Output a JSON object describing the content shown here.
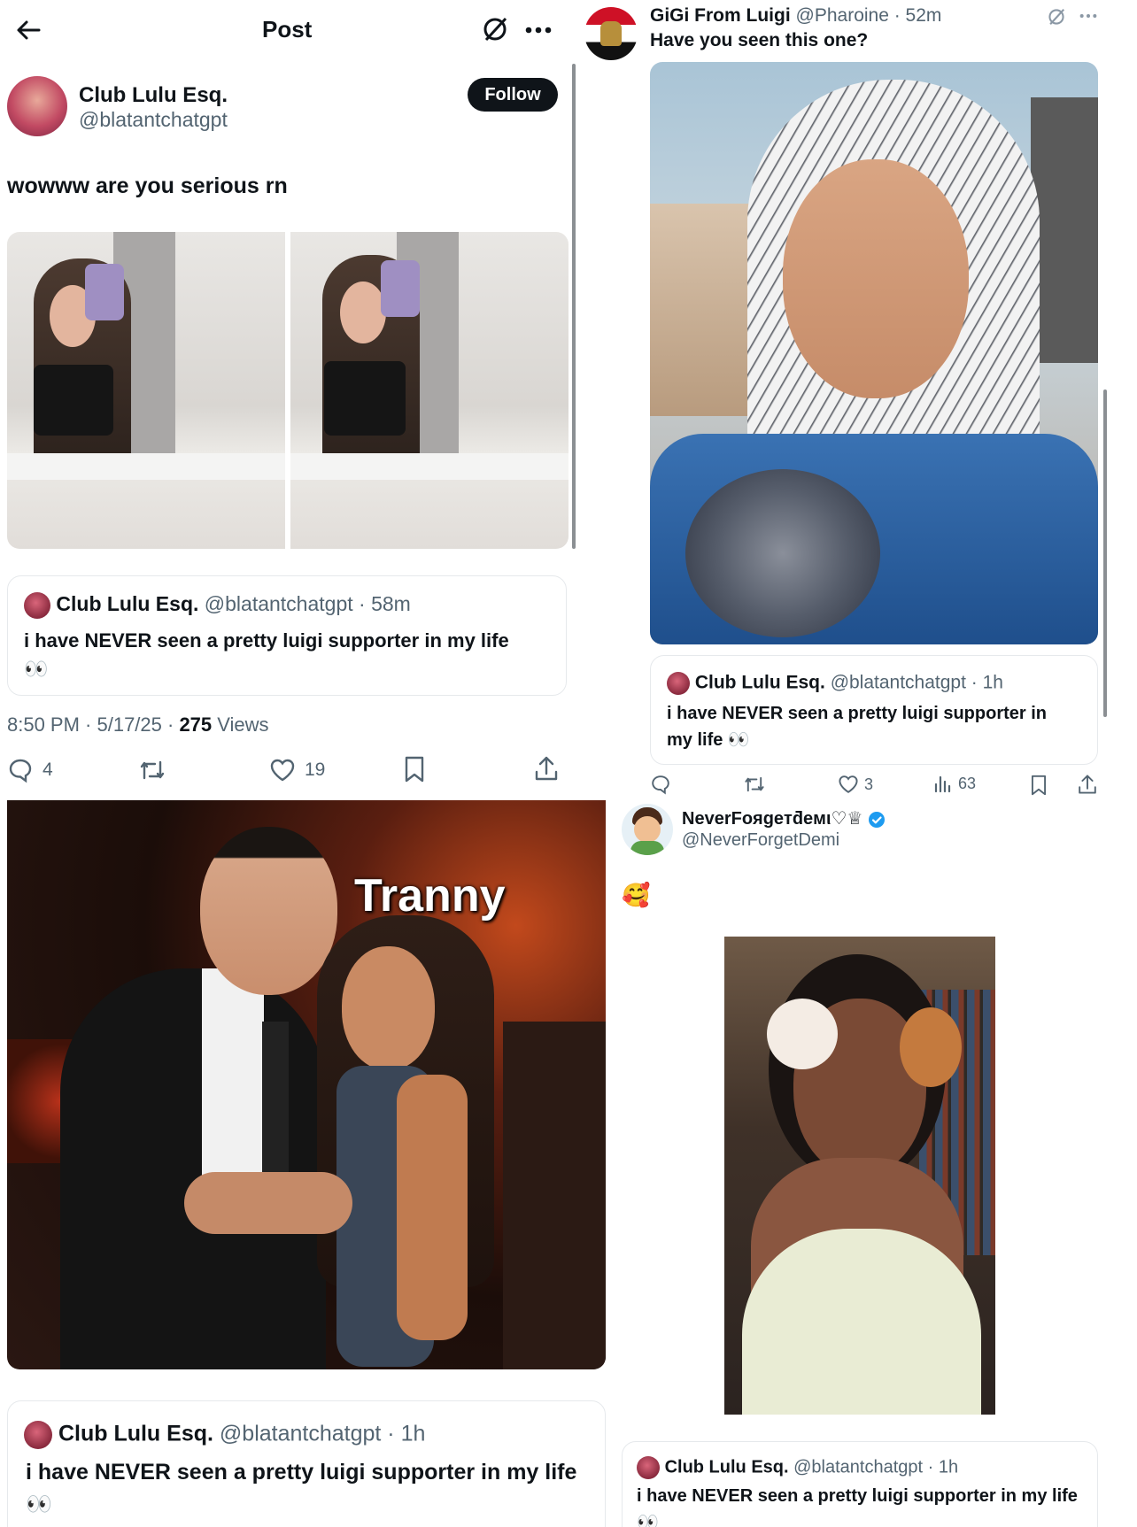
{
  "left": {
    "header": {
      "title": "Post"
    },
    "author": {
      "name": "Club Lulu Esq.",
      "handle": "@blatantchatgpt",
      "follow_label": "Follow"
    },
    "tweet_text": "wowww are you serious rn",
    "quote": {
      "name": "Club Lulu Esq.",
      "handle_time": "@blatantchatgpt · 58m",
      "text": "i have NEVER seen a pretty luigi supporter in my life",
      "emoji": "👀"
    },
    "meta": {
      "time_date": "8:50 PM · 5/17/25 · ",
      "views_count": "275",
      "views_label": " Views"
    },
    "actions": {
      "replies": "4",
      "likes": "19"
    }
  },
  "right_top": {
    "author": {
      "name": "GiGi From Luigi",
      "handle_time": "@Pharoine · 52m"
    },
    "text": "Have you seen this one?",
    "quote": {
      "name": "Club Lulu Esq.",
      "handle_time": "@blatantchatgpt · 1h",
      "text_line1": "i have NEVER seen a pretty luigi supporter in",
      "text_line2": "my life 👀"
    },
    "actions": {
      "likes": "3",
      "views": "63"
    }
  },
  "right_bottom": {
    "author": {
      "name": "NeverFoяgeтƌeмι♡♕",
      "handle": "@NeverForgetDemi"
    },
    "text": "🥰",
    "quote": {
      "name": "Club Lulu Esq.",
      "handle_time": "@blatantchatgpt · 1h",
      "text": "i have NEVER seen a pretty luigi supporter in my life",
      "emoji": "👀"
    }
  },
  "left_bottom": {
    "overlay_text": "Tranny",
    "quote": {
      "name": "Club Lulu Esq.",
      "handle_time": "@blatantchatgpt · 1h",
      "text": "i have NEVER seen a pretty luigi supporter in my life",
      "emoji": "👀"
    }
  },
  "colors": {
    "accent": "#1d9bf0",
    "text": "#0f1419",
    "muted": "#536471",
    "border": "#e6e9ec"
  },
  "icons": [
    "back-arrow-icon",
    "grok-icon",
    "more-icon",
    "reply-icon",
    "retweet-icon",
    "like-icon",
    "bookmark-icon",
    "share-icon",
    "views-icon",
    "verified-badge-icon"
  ]
}
